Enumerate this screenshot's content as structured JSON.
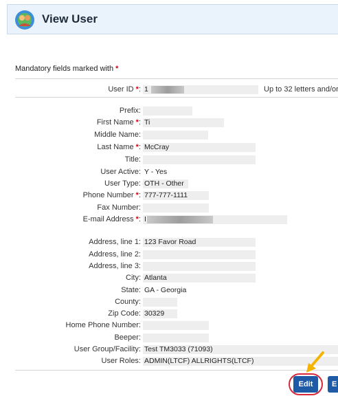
{
  "header": {
    "title": "View User"
  },
  "mandatory_note": "Mandatory fields marked with",
  "required_marker": "*",
  "user_id": {
    "label": "User ID",
    "value": "1",
    "hint": "Up to 32 letters and/or"
  },
  "fields": [
    {
      "label": "Prefix:",
      "value": "",
      "required": false
    },
    {
      "label": "First Name",
      "value": "Ti",
      "required": true
    },
    {
      "label": "Middle Name:",
      "value": "",
      "required": false
    },
    {
      "label": "Last Name",
      "value": "McCray",
      "required": true
    },
    {
      "label": "Title:",
      "value": "",
      "required": false
    },
    {
      "label": "User Active:",
      "value": "Y - Yes",
      "required": false
    },
    {
      "label": "User Type:",
      "value": "OTH - Other",
      "required": false
    },
    {
      "label": "Phone Number",
      "value": "777-777-1111",
      "required": true
    },
    {
      "label": "Fax Number:",
      "value": "",
      "required": false
    },
    {
      "label": "E-mail Address",
      "value": "I",
      "required": true
    }
  ],
  "address_fields": [
    {
      "label": "Address, line 1:",
      "value": "123 Favor Road"
    },
    {
      "label": "Address, line 2:",
      "value": ""
    },
    {
      "label": "Address, line 3:",
      "value": ""
    },
    {
      "label": "City:",
      "value": "Atlanta"
    },
    {
      "label": "State:",
      "value": "GA - Georgia"
    },
    {
      "label": "County:",
      "value": ""
    },
    {
      "label": "Zip Code:",
      "value": "30329"
    },
    {
      "label": "Home Phone Number:",
      "value": ""
    },
    {
      "label": "Beeper:",
      "value": ""
    },
    {
      "label": "User Group/Facility:",
      "value": "Test TM3033 (71093)"
    },
    {
      "label": "User Roles:",
      "value": "ADMIN(LTCF) ALLRIGHTS(LTCF)"
    }
  ],
  "buttons": {
    "edit": "Edit",
    "next": "E"
  },
  "colors": {
    "required": "#d0021b",
    "button": "#1f5aa6",
    "highlight_ring": "#d9263a",
    "arrow": "#f5b400"
  }
}
